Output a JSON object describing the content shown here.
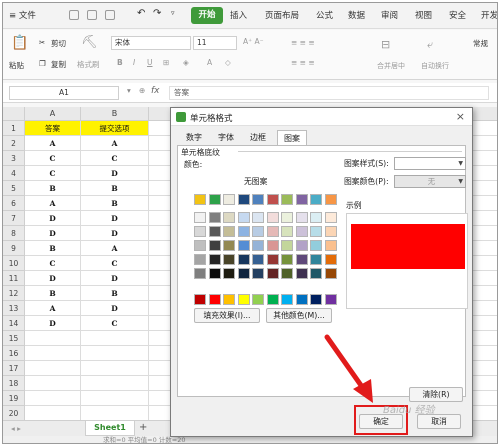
{
  "menubar": {
    "file_menu": "≡ 文件",
    "tabs": [
      "开始",
      "插入",
      "页面布局",
      "公式",
      "数据",
      "审阅",
      "视图",
      "安全",
      "开发"
    ]
  },
  "ribbon": {
    "paste": "粘贴",
    "cut": "剪切",
    "copy": "复制",
    "format_painter": "格式刷",
    "font_name": "宋体",
    "font_size": "11",
    "merge_center": "合并居中",
    "auto_wrap": "自动换行",
    "number_format": "常规"
  },
  "formula_bar": {
    "cell_ref": "A1",
    "fx": "fx",
    "content": "答案"
  },
  "sheet": {
    "columns": [
      "A",
      "B"
    ],
    "rows": [
      [
        "答案",
        "提交选项"
      ],
      [
        "A",
        "A"
      ],
      [
        "C",
        "C"
      ],
      [
        "C",
        "D"
      ],
      [
        "B",
        "B"
      ],
      [
        "A",
        "B"
      ],
      [
        "D",
        "D"
      ],
      [
        "D",
        "D"
      ],
      [
        "B",
        "A"
      ],
      [
        "C",
        "C"
      ],
      [
        "D",
        "D"
      ],
      [
        "B",
        "B"
      ],
      [
        "A",
        "D"
      ],
      [
        "D",
        "C"
      ],
      [
        "",
        ""
      ],
      [
        "",
        ""
      ],
      [
        "",
        ""
      ],
      [
        "",
        ""
      ],
      [
        "",
        ""
      ],
      [
        "",
        ""
      ]
    ],
    "header_fill": "#fff200",
    "tab_name": "Sheet1",
    "add_tab": "+",
    "status_text": "求和=0  平均值=0  计数=20"
  },
  "dialog": {
    "title": "单元格格式",
    "close": "×",
    "tabs": [
      "数字",
      "字体",
      "边框",
      "图案"
    ],
    "active_tab": "图案",
    "section_title": "单元格底纹",
    "color_label": "颜色:",
    "no_pattern": "无图案",
    "pattern_style_label": "图案样式(S):",
    "pattern_color_label": "图案颜色(P):",
    "pattern_color_value": "无",
    "sample_label": "示例",
    "sample_color": "#ff0000",
    "fill_effects_button": "填充效果(I)...",
    "more_colors_button": "其他颜色(M)...",
    "clear_button": "清除(R)",
    "ok_button": "确定",
    "cancel_button": "取消",
    "palette_row1": [
      "#ffffff",
      "#000000",
      "#eeece1",
      "#1f497d",
      "#4f81bd",
      "#c0504d",
      "#9bbb59",
      "#8064a2",
      "#4bacc6",
      "#f79646",
      "#f2c314",
      "#2ea24a"
    ],
    "palette_rows": [
      [
        "#f2f2f2",
        "#7f7f7f",
        "#ddd9c3",
        "#c6d9f0",
        "#dbe5f1",
        "#f2dcdb",
        "#ebf1dd",
        "#e5e0ec",
        "#dbeef3",
        "#fdeada",
        "#fff2cc",
        "#d8ecd0"
      ],
      [
        "#d8d8d8",
        "#595959",
        "#c4bd97",
        "#8db3e2",
        "#b8cce4",
        "#e5b9b7",
        "#d7e3bc",
        "#ccc1d9",
        "#b7dde8",
        "#fbd5b5",
        "#ffe599",
        "#b6dcaa"
      ],
      [
        "#bfbfbf",
        "#3f3f3f",
        "#938953",
        "#548dd4",
        "#95b3d7",
        "#d99694",
        "#c3d69b",
        "#b2a2c7",
        "#92cddc",
        "#fac08f",
        "#ffd966",
        "#93cc85"
      ],
      [
        "#a5a5a5",
        "#262626",
        "#494429",
        "#17365d",
        "#366092",
        "#953734",
        "#76923c",
        "#5f497a",
        "#31859b",
        "#e36c09",
        "#bf9000",
        "#548235"
      ],
      [
        "#7f7f7f",
        "#0c0c0c",
        "#1d1b10",
        "#0f243e",
        "#244061",
        "#632423",
        "#4f6128",
        "#3f3151",
        "#205867",
        "#974806",
        "#7f6000",
        "#375623"
      ]
    ],
    "palette_standard": [
      "#c00000",
      "#ff0000",
      "#ffc000",
      "#ffff00",
      "#92d050",
      "#00b050",
      "#00b0f0",
      "#0070c0",
      "#002060",
      "#7030a0"
    ]
  },
  "watermark": "Baidu 经验"
}
